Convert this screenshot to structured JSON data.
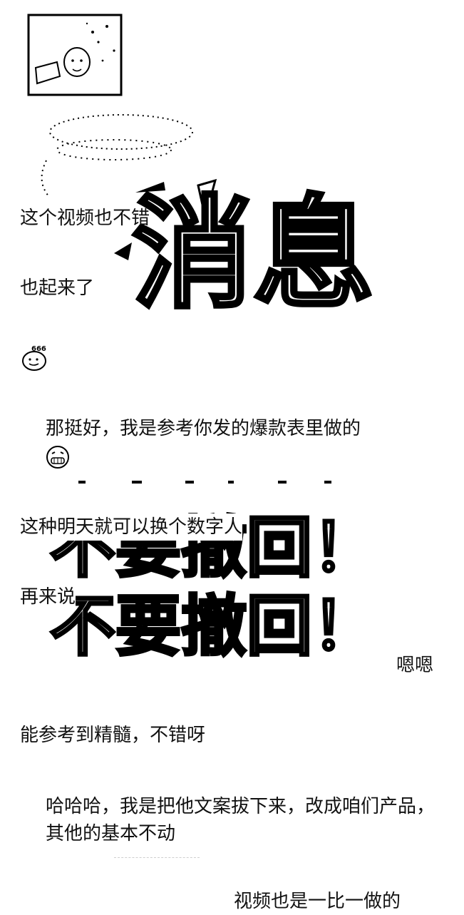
{
  "colors": {
    "background": "#ffffff",
    "text": "#111111",
    "sticker_stroke": "#000000"
  },
  "messages": {
    "m1": "这个视频也不错",
    "m2": "也起来了",
    "m3": "那挺好，我是参考你发的爆款表里做的",
    "m4": "这种明天就可以换个数字人",
    "m5": "再来说",
    "m6": "嗯嗯",
    "m7": "能参考到精髓，不错呀",
    "m8": "哈哈哈，我是把他文案拔下来，改成咱们产品，其他的基本不动",
    "m9": "视频也是一比一做的"
  },
  "stickers": {
    "top": {
      "text": "消息",
      "icon": "withdraw-message-sticker-icon"
    },
    "bottom": {
      "line1": "不要撤回！",
      "line2": "不要撤回！",
      "icon": "dont-withdraw-sticker-icon"
    }
  },
  "emojis": {
    "e666": {
      "label": "666",
      "icon": "666-emoji-icon"
    },
    "grin": {
      "icon": "grin-emoji-icon"
    }
  }
}
